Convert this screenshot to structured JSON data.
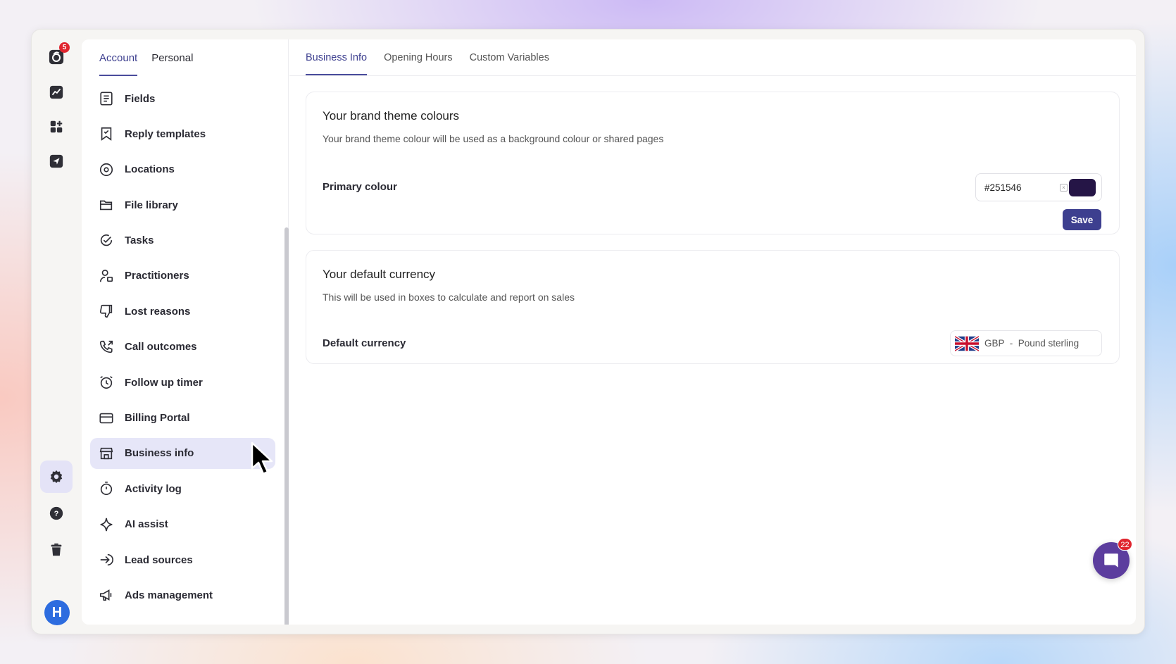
{
  "rail": {
    "logo_badge": "5",
    "items": [
      "analytics-icon",
      "apps-add-icon",
      "send-icon"
    ],
    "bottom_items": [
      "settings-icon",
      "help-icon",
      "trash-icon"
    ],
    "avatar_initial": "H"
  },
  "settings_nav": {
    "tabs": [
      {
        "label": "Account",
        "active": true
      },
      {
        "label": "Personal",
        "active": false
      }
    ],
    "items": [
      {
        "label": "Fields",
        "icon": "fields-icon"
      },
      {
        "label": "Reply templates",
        "icon": "bookmark-icon"
      },
      {
        "label": "Locations",
        "icon": "location-pin-icon"
      },
      {
        "label": "File library",
        "icon": "folder-icon"
      },
      {
        "label": "Tasks",
        "icon": "check-circle-icon"
      },
      {
        "label": "Practitioners",
        "icon": "user-badge-icon"
      },
      {
        "label": "Lost reasons",
        "icon": "thumbs-down-icon"
      },
      {
        "label": "Call outcomes",
        "icon": "phone-outgoing-icon"
      },
      {
        "label": "Follow up timer",
        "icon": "alarm-clock-icon"
      },
      {
        "label": "Billing Portal",
        "icon": "credit-card-icon"
      },
      {
        "label": "Business info",
        "icon": "store-icon",
        "active": true
      },
      {
        "label": "Activity log",
        "icon": "stopwatch-icon"
      },
      {
        "label": "AI assist",
        "icon": "sparkle-icon"
      },
      {
        "label": "Lead sources",
        "icon": "sign-in-icon"
      },
      {
        "label": "Ads management",
        "icon": "megaphone-icon"
      }
    ]
  },
  "main": {
    "tabs": [
      {
        "label": "Business Info",
        "active": true
      },
      {
        "label": "Opening Hours",
        "active": false
      },
      {
        "label": "Custom Variables",
        "active": false
      }
    ],
    "brand_card": {
      "title": "Your brand theme colours",
      "description": "Your brand theme colour will be used as a background colour or shared pages",
      "primary_label": "Primary colour",
      "primary_value": "#251546",
      "save_label": "Save"
    },
    "currency_card": {
      "title": "Your default currency",
      "description": "This will be used in boxes to calculate and report on sales",
      "default_label": "Default currency",
      "selected": "GBP  -  Pound sterling"
    }
  },
  "chat": {
    "badge": "22"
  },
  "colors": {
    "accent": "#3d3f8f",
    "active_bg": "#e6e6f8",
    "primary_swatch": "#251546",
    "badge_red": "#e0262f",
    "chat_purple": "#5c3d9e"
  }
}
